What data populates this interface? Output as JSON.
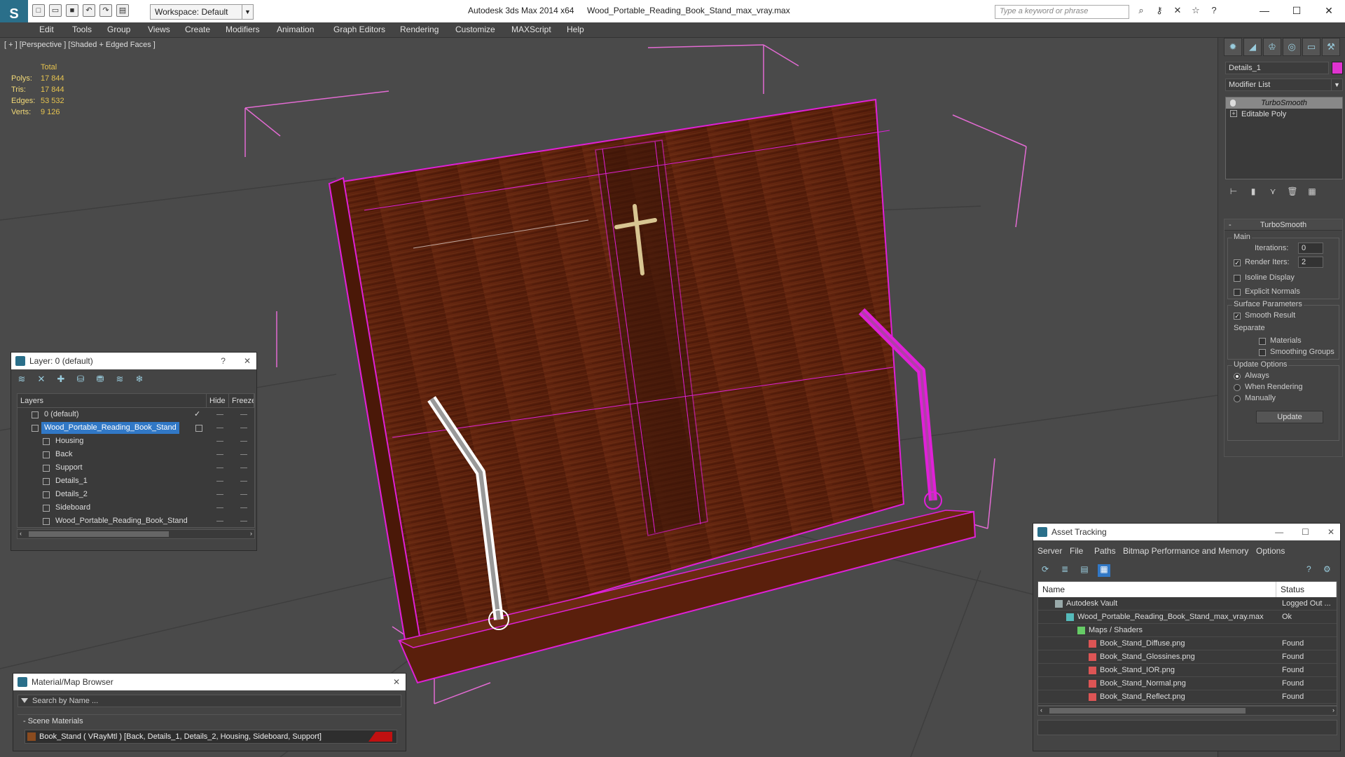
{
  "titlebar": {
    "workspace_label": "Workspace: Default",
    "app_name": "Autodesk 3ds Max  2014 x64",
    "file_name": "Wood_Portable_Reading_Book_Stand_max_vray.max",
    "search_placeholder": "Type a keyword or phrase"
  },
  "menu": [
    "Edit",
    "Tools",
    "Group",
    "Views",
    "Create",
    "Modifiers",
    "Animation",
    "Graph Editors",
    "Rendering",
    "Customize",
    "MAXScript",
    "Help"
  ],
  "viewport": {
    "label": "[ + ] [Perspective ] [Shaded + Edged Faces ]",
    "stats": {
      "total_label": "Total",
      "rows": [
        {
          "label": "Polys:",
          "value": "17 844"
        },
        {
          "label": "Tris:",
          "value": "17 844"
        },
        {
          "label": "Edges:",
          "value": "53 532"
        },
        {
          "label": "Verts:",
          "value": "9 126"
        }
      ]
    },
    "colors": {
      "wire": "#e020d8",
      "wood": "#5a1f0c",
      "background": "#4a4a4a"
    }
  },
  "command_panel": {
    "object_name": "Details_1",
    "object_color": "#e033d0",
    "modifier_list_label": "Modifier List",
    "stack": [
      {
        "label": "TurboSmooth",
        "selected": true
      },
      {
        "label": "Editable Poly",
        "selected": false
      }
    ],
    "rollout": {
      "title": "TurboSmooth",
      "main_group": "Main",
      "iterations_label": "Iterations:",
      "iterations_value": "0",
      "render_iters_label": "Render Iters:",
      "render_iters_value": "2",
      "isoline_label": "Isoline Display",
      "explicit_normals_label": "Explicit Normals",
      "surface_group": "Surface Parameters",
      "smooth_result_label": "Smooth Result",
      "separate_label": "Separate",
      "materials_label": "Materials",
      "smoothing_groups_label": "Smoothing Groups",
      "update_group": "Update Options",
      "always_label": "Always",
      "when_rendering_label": "When Rendering",
      "manually_label": "Manually",
      "update_button": "Update"
    }
  },
  "layer_window": {
    "title": "Layer: 0 (default)",
    "help": "?",
    "columns": [
      "Layers",
      "Hide",
      "Freeze"
    ],
    "rows": [
      {
        "name": "0 (default)",
        "level": 0,
        "selected": false,
        "current": true
      },
      {
        "name": "Wood_Portable_Reading_Book_Stand",
        "level": 0,
        "selected": true,
        "current": false
      },
      {
        "name": "Housing",
        "level": 1,
        "selected": false,
        "current": false
      },
      {
        "name": "Back",
        "level": 1,
        "selected": false,
        "current": false
      },
      {
        "name": "Support",
        "level": 1,
        "selected": false,
        "current": false
      },
      {
        "name": "Details_1",
        "level": 1,
        "selected": false,
        "current": false
      },
      {
        "name": "Details_2",
        "level": 1,
        "selected": false,
        "current": false
      },
      {
        "name": "Sideboard",
        "level": 1,
        "selected": false,
        "current": false
      },
      {
        "name": "Wood_Portable_Reading_Book_Stand",
        "level": 1,
        "selected": false,
        "current": false
      }
    ]
  },
  "material_browser": {
    "title": "Material/Map Browser",
    "search_placeholder": "Search by Name ...",
    "group_label": "- Scene Materials",
    "item_label": "Book_Stand  ( VRayMtl ) [Back, Details_1, Details_2, Housing, Sideboard, Support]"
  },
  "asset_tracking": {
    "title": "Asset Tracking",
    "menu": [
      "Server",
      "File",
      "Paths",
      "Bitmap Performance and Memory",
      "Options"
    ],
    "columns": [
      "Name",
      "Status"
    ],
    "rows": [
      {
        "name": "Autodesk Vault",
        "status": "Logged Out ...",
        "level": 0,
        "icon": "vault"
      },
      {
        "name": "Wood_Portable_Reading_Book_Stand_max_vray.max",
        "status": "Ok",
        "level": 1,
        "icon": "max-file"
      },
      {
        "name": "Maps / Shaders",
        "status": "",
        "level": 2,
        "icon": "maps"
      },
      {
        "name": "Book_Stand_Diffuse.png",
        "status": "Found",
        "level": 3,
        "icon": "png"
      },
      {
        "name": "Book_Stand_Glossines.png",
        "status": "Found",
        "level": 3,
        "icon": "png"
      },
      {
        "name": "Book_Stand_IOR.png",
        "status": "Found",
        "level": 3,
        "icon": "png"
      },
      {
        "name": "Book_Stand_Normal.png",
        "status": "Found",
        "level": 3,
        "icon": "png"
      },
      {
        "name": "Book_Stand_Reflect.png",
        "status": "Found",
        "level": 3,
        "icon": "png"
      }
    ]
  }
}
